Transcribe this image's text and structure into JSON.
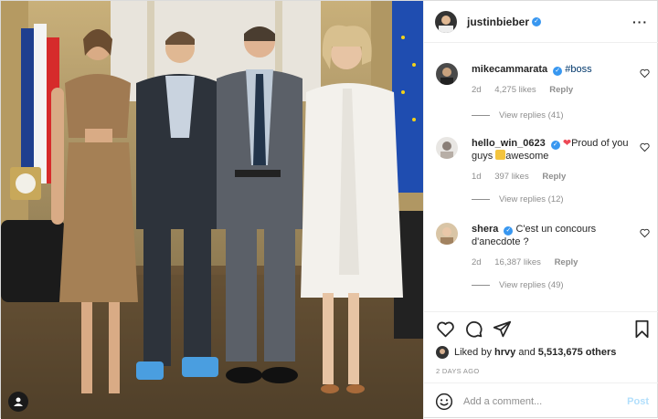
{
  "post": {
    "author": "justinbieber",
    "verified": true,
    "more_icon": "more-horizontal-icon"
  },
  "comments": [
    {
      "user": "mikecammarata",
      "verified": true,
      "text": "#boss",
      "age": "2d",
      "likes": "4,275 likes",
      "reply": "Reply",
      "view_replies": "View replies (41)"
    },
    {
      "user": "hello_win_0623",
      "verified": true,
      "text_before": "Proud of you guys ",
      "text_after": "awesome",
      "age": "1d",
      "likes": "397 likes",
      "reply": "Reply",
      "view_replies": "View replies (12)"
    },
    {
      "user": "shera",
      "verified": true,
      "text": "C'est un concours d'anecdote ?",
      "age": "2d",
      "likes": "16,387 likes",
      "reply": "Reply",
      "view_replies": "View replies (49)"
    }
  ],
  "liked_by": {
    "prefix": "Liked by",
    "user": "hrvy",
    "connector": "and",
    "others": "5,513,675 others"
  },
  "date": "2 DAYS AGO",
  "add_comment": {
    "placeholder": "Add a comment...",
    "post_label": "Post"
  },
  "colors": {
    "verified": "#3897f0",
    "muted": "#8e8e8e",
    "post_disabled": "#b2dffc",
    "heart_red": "#ed4956"
  }
}
